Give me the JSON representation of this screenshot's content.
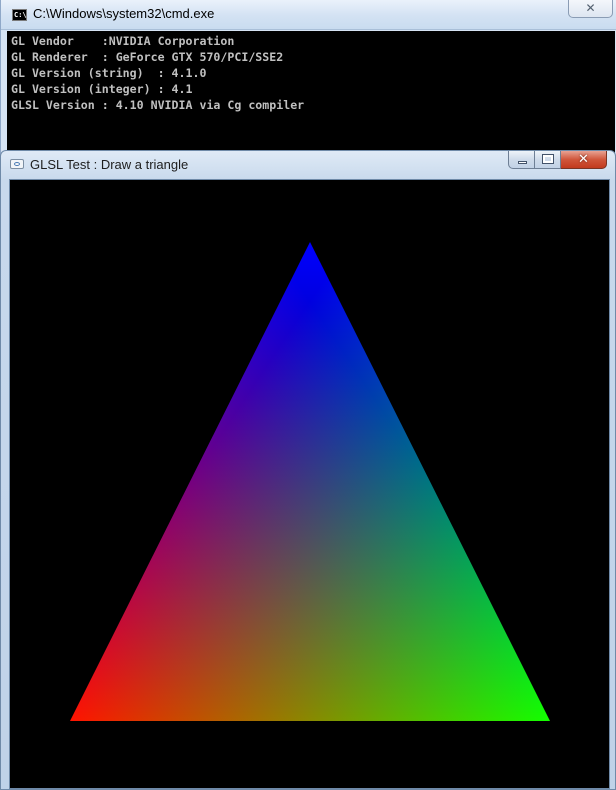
{
  "cmd": {
    "title": "C:\\Windows\\system32\\cmd.exe",
    "icon": "console-icon",
    "close_symbol": "✕",
    "background_color": "#000000",
    "text_color": "#c0c0c0",
    "lines": [
      "GL Vendor    :NVIDIA Corporation",
      "GL Renderer  : GeForce GTX 570/PCI/SSE2",
      "GL Version (string)  : 4.1.0",
      "GL Version (integer) : 4.1",
      "GLSL Version : 4.10 NVIDIA via Cg compiler"
    ]
  },
  "glsl_window": {
    "title": "GLSL Test : Draw a triangle",
    "icon": "window-app-icon",
    "close_symbol": "✕",
    "canvas_background": "#000000",
    "triangle": {
      "vertex_colors": {
        "top": "#0000ff",
        "bottom_left": "#ff0000",
        "bottom_right": "#00ff00"
      }
    }
  }
}
